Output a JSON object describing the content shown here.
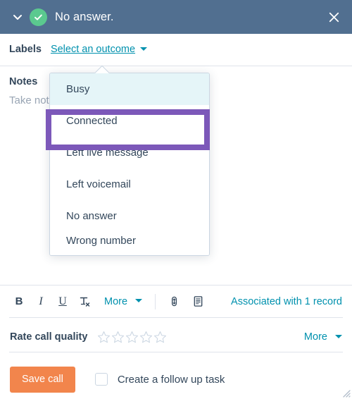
{
  "header": {
    "collapse_icon": "chevron-down-icon",
    "status_icon": "check-circle-icon",
    "status_color": "#5bc98f",
    "title": "No answer.",
    "close_icon": "close-icon",
    "background": "#516f90"
  },
  "labels": {
    "label": "Labels",
    "link_text": "Select an outcome",
    "link_color": "#0091ae",
    "caret_icon": "chevron-down-icon"
  },
  "notes": {
    "label": "Notes",
    "placeholder": "Take notes"
  },
  "dropdown": {
    "highlight_color": "#7c58b9",
    "hover_color": "#e5f5f8",
    "items": [
      {
        "label": "Busy",
        "state": "hovered"
      },
      {
        "label": "Connected",
        "state": "highlighted"
      },
      {
        "label": "Left live message",
        "state": "normal"
      },
      {
        "label": "Left voicemail",
        "state": "normal"
      },
      {
        "label": "No answer",
        "state": "normal"
      },
      {
        "label": "Wrong number",
        "state": "clipped"
      }
    ]
  },
  "toolbar": {
    "bold_label": "B",
    "italic_label": "I",
    "underline_label": "U",
    "clear_format_icon": "clear-formatting-icon",
    "clear_format_label": "T",
    "more_label": "More",
    "more_caret_icon": "chevron-down-icon",
    "attachment_icon": "attachment-icon",
    "template_icon": "document-template-icon",
    "associated_label": "Associated with 1 record",
    "link_color": "#0091ae"
  },
  "rating": {
    "label": "Rate call quality",
    "stars_total": 5,
    "stars_filled": 0,
    "star_icon": "star-outline-icon",
    "more_label": "More",
    "more_caret_icon": "chevron-down-icon"
  },
  "footer": {
    "save_label": "Save call",
    "save_color": "#f2854c",
    "checkbox_checked": false,
    "follow_up_label": "Create a follow up task",
    "resize_icon": "resize-grip-icon"
  }
}
